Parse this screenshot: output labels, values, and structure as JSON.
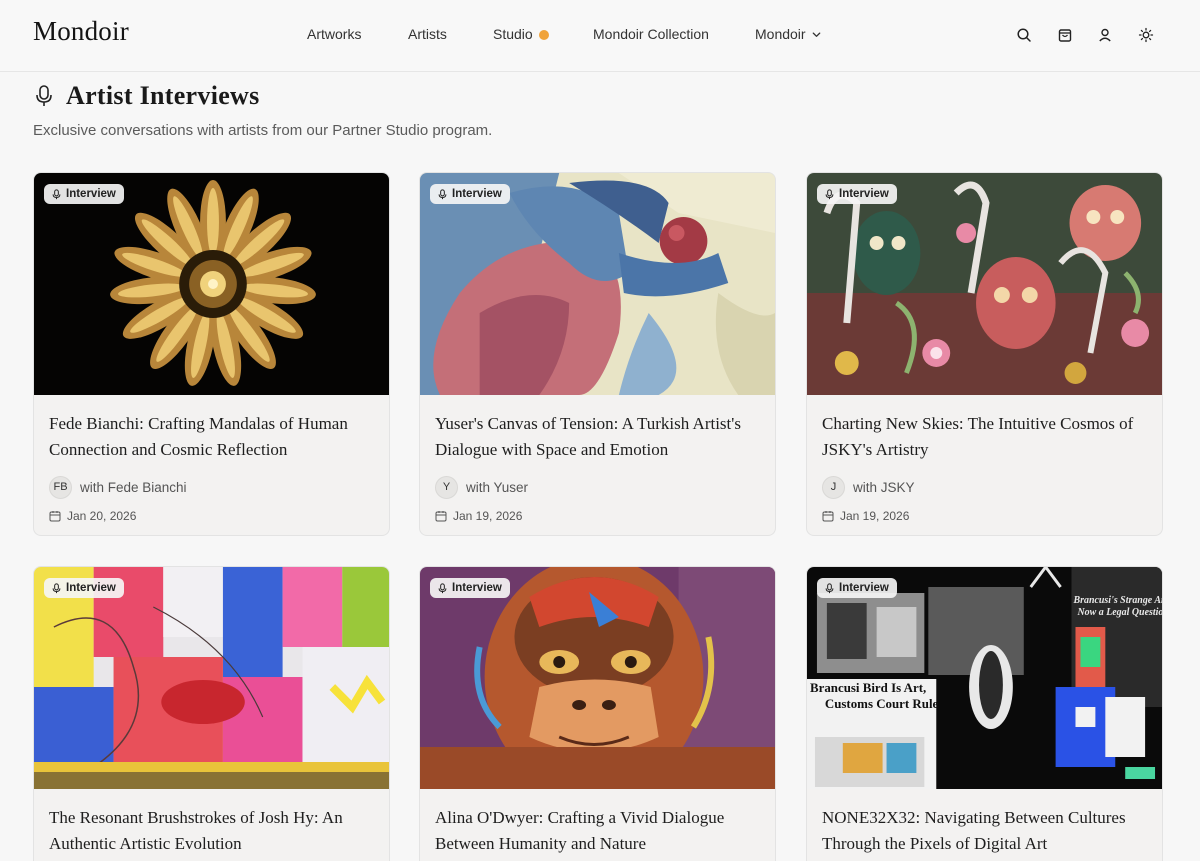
{
  "header": {
    "logo": "Mondoir",
    "nav": [
      {
        "label": "Artworks"
      },
      {
        "label": "Artists"
      },
      {
        "label": "Studio"
      },
      {
        "label": "Mondoir Collection"
      },
      {
        "label": "Mondoir"
      }
    ],
    "icons": [
      "search-icon",
      "shopping-bag-icon",
      "user-icon",
      "sun-icon"
    ],
    "studio_dot_color": "#f0a33a"
  },
  "page": {
    "title": "Artist Interviews",
    "subtitle": "Exclusive conversations with artists from our Partner Studio program."
  },
  "cards": [
    {
      "badge": "Interview",
      "title": "Fede Bianchi: Crafting Mandalas of Human Connection and Cosmic Reflection",
      "avatar": "FB",
      "author": "with Fede Bianchi",
      "date": "Jan 20, 2026"
    },
    {
      "badge": "Interview",
      "title": "Yuser's Canvas of Tension: A Turkish Artist's Dialogue with Space and Emotion",
      "avatar": "Y",
      "author": "with Yuser",
      "date": "Jan 19, 2026"
    },
    {
      "badge": "Interview",
      "title": "Charting New Skies: The Intuitive Cosmos of JSKY's Artistry",
      "avatar": "J",
      "author": "with JSKY",
      "date": "Jan 19, 2026"
    },
    {
      "badge": "Interview",
      "title": "The Resonant Brushstrokes of Josh Hy: An Authentic Artistic Evolution",
      "avatar": "",
      "author": "",
      "date": ""
    },
    {
      "badge": "Interview",
      "title": "Alina O'Dwyer: Crafting a Vivid Dialogue Between Humanity and Nature",
      "avatar": "",
      "author": "",
      "date": ""
    },
    {
      "badge": "Interview",
      "title": "NONE32X32: Navigating Between Cultures Through the Pixels of Digital Art",
      "avatar": "",
      "author": "",
      "date": ""
    }
  ],
  "artwork_text": {
    "card6_headline_1": "Brancusi Bird Is Art,",
    "card6_headline_2": "Customs Court Rule",
    "card6_side_1": "Brancusi's Strange Art",
    "card6_side_2": "Now a Legal Question"
  }
}
